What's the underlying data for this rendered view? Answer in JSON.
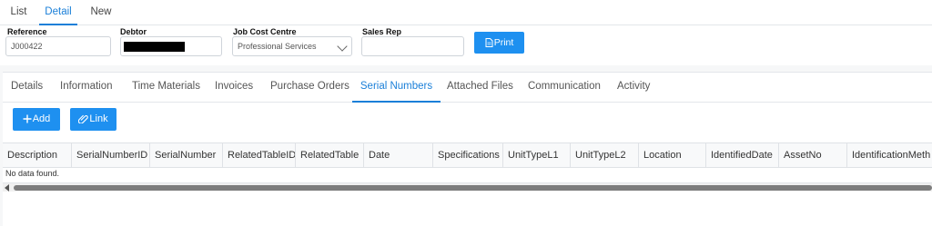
{
  "top_tabs": [
    {
      "label": "List",
      "active": false
    },
    {
      "label": "Detail",
      "active": true
    },
    {
      "label": "New",
      "active": false
    }
  ],
  "form": {
    "reference_label": "Reference",
    "reference_value": "J000422",
    "debtor_label": "Debtor",
    "job_cost_centre_label": "Job Cost Centre",
    "job_cost_centre_value": "Professional Services",
    "sales_rep_label": "Sales Rep",
    "sales_rep_value": "",
    "print_label": "Print"
  },
  "sub_tabs": [
    {
      "label": "Details",
      "active": false
    },
    {
      "label": "Information",
      "active": false
    },
    {
      "label": "Time Materials",
      "active": false
    },
    {
      "label": "Invoices",
      "active": false
    },
    {
      "label": "Purchase Orders",
      "active": false
    },
    {
      "label": "Serial Numbers",
      "active": true
    },
    {
      "label": "Attached Files",
      "active": false
    },
    {
      "label": "Communication",
      "active": false
    },
    {
      "label": "Activity",
      "active": false
    }
  ],
  "actions": {
    "add_label": "Add",
    "link_label": "Link"
  },
  "grid": {
    "columns": [
      "Description",
      "SerialNumberID",
      "SerialNumber",
      "RelatedTableID",
      "RelatedTable",
      "Date",
      "Specifications",
      "UnitTypeL1",
      "UnitTypeL2",
      "Location",
      "IdentifiedDate",
      "AssetNo",
      "IdentificationMeth"
    ],
    "empty_text": "No data found."
  },
  "colors": {
    "accent": "#1a7fd8",
    "button": "#1e90f0"
  }
}
